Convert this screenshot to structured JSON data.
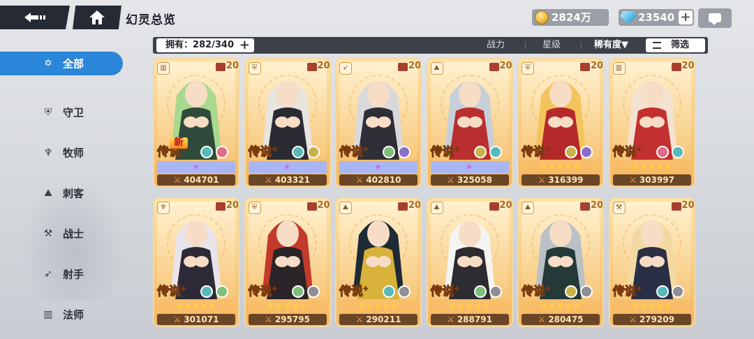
{
  "header": {
    "title": "幻灵总览",
    "gold": "2824万",
    "gems": "23540"
  },
  "sidebar": {
    "items": [
      {
        "label": "全部",
        "icon": "all-star-icon",
        "active": true
      },
      {
        "label": "守卫",
        "icon": "shield-icon",
        "active": false
      },
      {
        "label": "牧师",
        "icon": "priest-wings-icon",
        "active": false
      },
      {
        "label": "刺客",
        "icon": "assassin-icon",
        "active": false
      },
      {
        "label": "战士",
        "icon": "axe-icon",
        "active": false
      },
      {
        "label": "射手",
        "icon": "bow-icon",
        "active": false
      },
      {
        "label": "法师",
        "icon": "book-icon",
        "active": false
      }
    ]
  },
  "filterbar": {
    "owned": "拥有：282/340",
    "sort_power": "战力",
    "sort_stars": "星级",
    "sort_rarity": "稀有度▼",
    "filter": "筛选"
  },
  "cards": [
    {
      "level": "20",
      "rarity": "传说",
      "power": "404701",
      "stars": "★",
      "star_style": "purple",
      "class_icon": "book-icon",
      "elements": [
        "#58b9b9",
        "#e26b87"
      ],
      "hair": "#a9d88f",
      "outfit": "#2f4a3a"
    },
    {
      "level": "20",
      "rarity": "传说",
      "power": "403321",
      "stars": "★",
      "star_style": "purple",
      "class_icon": "shield-icon",
      "elements": [
        "#58b9b9",
        "#c9b24a"
      ],
      "hair": "#e8e4e0",
      "outfit": "#2a2a33"
    },
    {
      "level": "20",
      "rarity": "传说",
      "power": "402810",
      "stars": "★",
      "star_style": "purple",
      "class_icon": "bow-icon",
      "elements": [
        "#7fbf7a",
        "#8a6fc9"
      ],
      "hair": "#d9d9dc",
      "outfit": "#2e2f36"
    },
    {
      "level": "20",
      "rarity": "传说",
      "power": "325058",
      "stars": "★",
      "star_style": "purple",
      "class_icon": "assassin-icon",
      "elements": [
        "#c9b24a",
        "#58b9b9"
      ],
      "hair": "#c7cfd8",
      "outfit": "#b92f2f"
    },
    {
      "level": "20",
      "rarity": "传说",
      "power": "316399",
      "stars": "★★★★★",
      "star_style": "gold",
      "class_icon": "shield-icon",
      "elements": [
        "#c9b24a",
        "#8a6fc9"
      ],
      "hair": "#f2c45b",
      "outfit": "#b5292a"
    },
    {
      "level": "20",
      "rarity": "传说",
      "power": "303997",
      "stars": "★★★★★",
      "star_style": "gold",
      "class_icon": "book-icon",
      "elements": [
        "#e26b87",
        "#58b9b9"
      ],
      "hair": "#f4e2d0",
      "outfit": "#c23030"
    },
    {
      "level": "20",
      "rarity": "传说",
      "power": "301071",
      "stars": "★★★★★",
      "star_style": "gold",
      "class_icon": "priest-wings-icon",
      "elements": [
        "#58b9b9",
        "#7fbf7a"
      ],
      "hair": "#e8e4ea",
      "outfit": "#2c2a36"
    },
    {
      "level": "20",
      "rarity": "传说",
      "power": "295795",
      "stars": "★★★★★",
      "star_style": "gold",
      "class_icon": "shield-icon",
      "elements": [
        "#7fbf7a",
        "#8d8f95"
      ],
      "hair": "#c23a2a",
      "outfit": "#2b2428"
    },
    {
      "level": "20",
      "rarity": "传说",
      "power": "290211",
      "stars": "★★★★★",
      "star_style": "gold",
      "class_icon": "assassin-icon",
      "elements": [
        "#58b9b9",
        "#8d8f95"
      ],
      "hair": "#1e2a34",
      "outfit": "#d8b23a"
    },
    {
      "level": "20",
      "rarity": "传说",
      "power": "288791",
      "stars": "★★★★★",
      "star_style": "gold",
      "class_icon": "assassin-icon",
      "elements": [
        "#7fbf7a",
        "#8d8f95"
      ],
      "hair": "#f4f4f2",
      "outfit": "#2d2d31"
    },
    {
      "level": "20",
      "rarity": "传说",
      "power": "280475",
      "stars": "★★★★★",
      "star_style": "gold",
      "class_icon": "assassin-icon",
      "elements": [
        "#c9b24a",
        "#8d8f95"
      ],
      "hair": "#b9c1c6",
      "outfit": "#243a38"
    },
    {
      "level": "20",
      "rarity": "传说",
      "power": "279209",
      "stars": "★★★★★",
      "star_style": "gold",
      "class_icon": "axe-icon",
      "elements": [
        "#58b9b9",
        "#8d8f95"
      ],
      "hair": "#f2d9a4",
      "outfit": "#2a2f45"
    }
  ],
  "new_badge": "新"
}
